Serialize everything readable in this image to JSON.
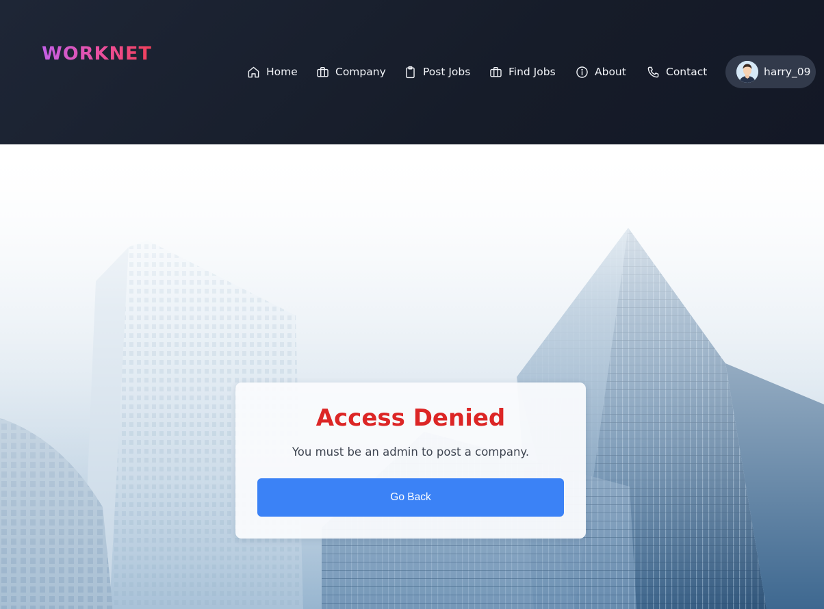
{
  "brand": {
    "name": "WORKNET"
  },
  "nav": {
    "items": [
      {
        "label": "Home",
        "icon": "home-icon"
      },
      {
        "label": "Company",
        "icon": "briefcase-icon"
      },
      {
        "label": "Post Jobs",
        "icon": "clipboard-icon"
      },
      {
        "label": "Find Jobs",
        "icon": "briefcase-icon"
      },
      {
        "label": "About",
        "icon": "info-icon"
      },
      {
        "label": "Contact",
        "icon": "phone-icon"
      }
    ]
  },
  "user": {
    "username": "harry_09",
    "avatar_icon": "user-avatar"
  },
  "dialog": {
    "title": "Access Denied",
    "message": "You must be an admin to post a company.",
    "button_label": "Go Back"
  },
  "colors": {
    "header_bg": "#1a2030",
    "title_red": "#dc2626",
    "button_blue": "#3b82f6",
    "logo_gradient_start": "#c45fe6",
    "logo_gradient_end": "#f0405a"
  }
}
